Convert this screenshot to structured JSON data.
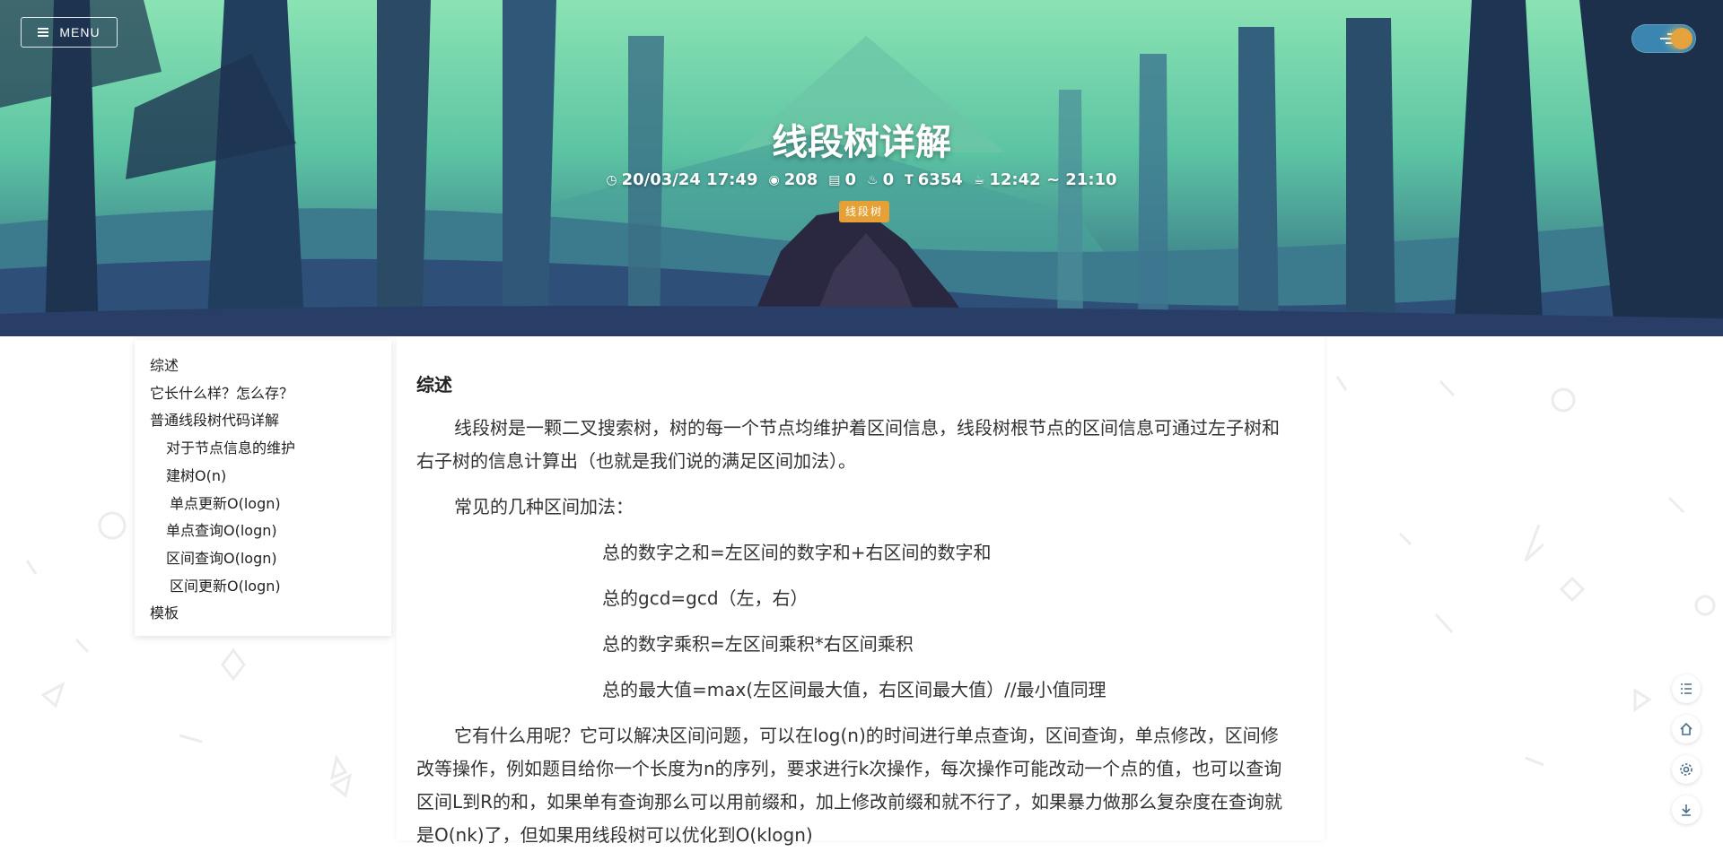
{
  "header": {
    "menu_label": "MENU",
    "title": "线段树详解",
    "meta": {
      "date": "20/03/24 17:49",
      "views": "208",
      "comments": "0",
      "likes": "0",
      "words": "6354",
      "read_time": "12:42 ~ 21:10"
    },
    "tag": "线段树"
  },
  "toc": {
    "items": [
      {
        "label": "综述",
        "level": 1
      },
      {
        "label": "它长什么样？怎么存？",
        "level": 1
      },
      {
        "label": "普通线段树代码详解",
        "level": 1
      },
      {
        "label": "对于节点信息的维护",
        "level": 2
      },
      {
        "label": "建树O(n)",
        "level": 2
      },
      {
        "label": "单点更新O(logn)",
        "level": 3
      },
      {
        "label": "单点查询O(logn)",
        "level": 2
      },
      {
        "label": "区间查询O(logn)",
        "level": 2
      },
      {
        "label": "区间更新O(logn)",
        "level": 3
      },
      {
        "label": "模板",
        "level": 1
      }
    ]
  },
  "article": {
    "heading": "综述",
    "para1": "线段树是一颗二叉搜索树，树的每一个节点均维护着区间信息，线段树根节点的区间信息可通过左子树和右子树的信息计算出（也就是我们说的满足区间加法）。",
    "para2": "常见的几种区间加法：",
    "formulas": [
      "总的数字之和=左区间的数字和+右区间的数字和",
      "总的gcd=gcd（左，右）",
      "总的数字乘积=左区间乘积*右区间乘积",
      "总的最大值=max(左区间最大值，右区间最大值）//最小值同理"
    ],
    "para3": "它有什么用呢？它可以解决区间问题，可以在log(n)的时间进行单点查询，区间查询，单点修改，区间修改等操作，例如题目给你一个长度为n的序列，要求进行k次操作，每次操作可能改动一个点的值，也可以查询区间L到R的和，如果单有查询那么可以用前缀和，加上修改前缀和就不行了，如果暴力做那么复杂度在查询就是O(nk)了，但如果用线段树可以优化到O(klogn)"
  },
  "tools": [
    "toc-icon",
    "home-icon",
    "gear-icon",
    "download-icon"
  ]
}
